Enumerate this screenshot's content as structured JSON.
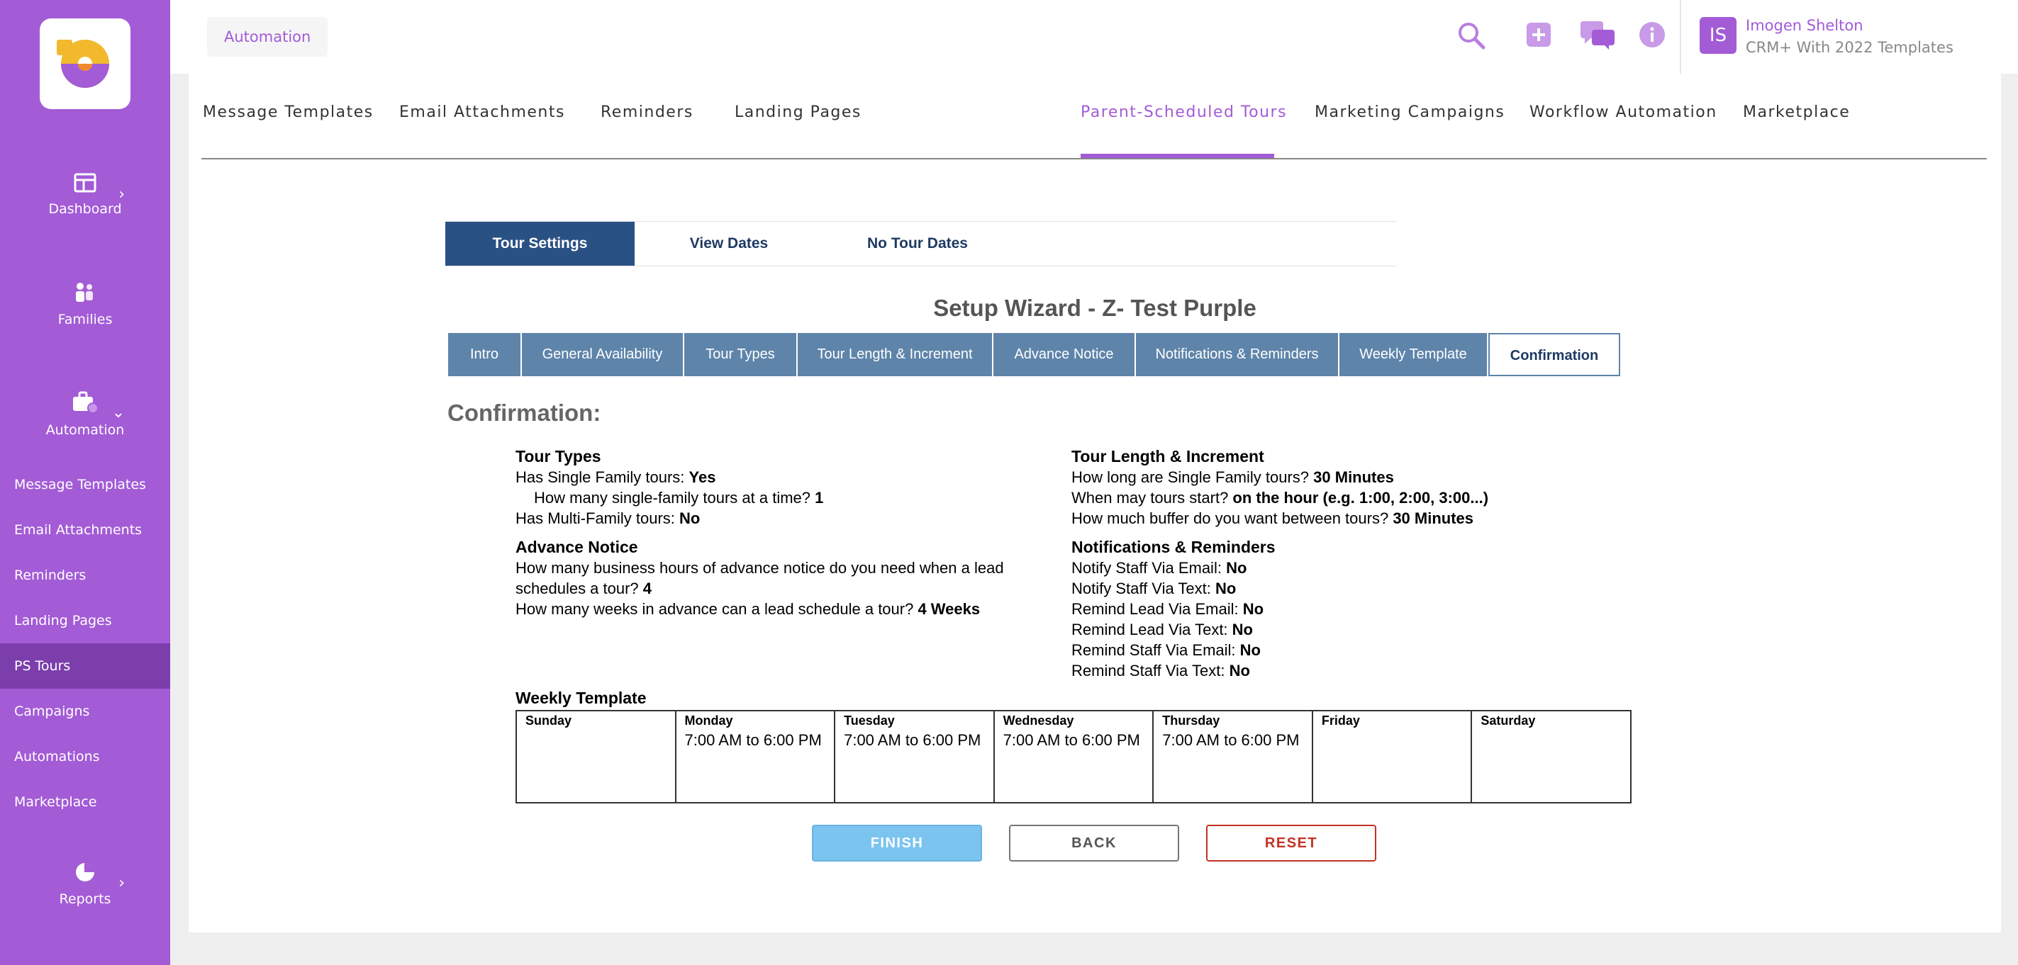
{
  "sidebar": {
    "nav": [
      {
        "label": "Dashboard",
        "icon": "dashboard-icon"
      },
      {
        "label": "Families",
        "icon": "families-icon"
      },
      {
        "label": "Automation",
        "icon": "automation-icon"
      },
      {
        "label": "Reports",
        "icon": "reports-icon"
      }
    ],
    "sub_items": [
      {
        "label": "Message Templates"
      },
      {
        "label": "Email Attachments"
      },
      {
        "label": "Reminders"
      },
      {
        "label": "Landing Pages"
      },
      {
        "label": "PS Tours",
        "active": true
      },
      {
        "label": "Campaigns"
      },
      {
        "label": "Automations"
      },
      {
        "label": "Marketplace"
      }
    ]
  },
  "topbar": {
    "breadcrumb": "Automation",
    "user": {
      "initials": "IS",
      "name": "Imogen Shelton",
      "org": "CRM+ With 2022 Templates"
    }
  },
  "tabs": [
    "Message Templates",
    "Email Attachments",
    "Reminders",
    "Landing Pages",
    "Parent-Scheduled Tours",
    "Marketing Campaigns",
    "Workflow Automation",
    "Marketplace"
  ],
  "active_tab": "Parent-Scheduled Tours",
  "subtabs": [
    "Tour Settings",
    "View Dates",
    "No Tour Dates"
  ],
  "wizard": {
    "title": "Setup Wizard - Z- Test Purple",
    "steps": [
      "Intro",
      "General Availability",
      "Tour Types",
      "Tour Length & Increment",
      "Advance Notice",
      "Notifications & Reminders",
      "Weekly Template",
      "Confirmation"
    ],
    "active_step": "Confirmation"
  },
  "confirmation": {
    "heading": "Confirmation:",
    "tour_types": {
      "title": "Tour Types",
      "q1": "Has Single Family tours: ",
      "a1": "Yes",
      "q2": "How many single-family tours at a time? ",
      "a2": "1",
      "q3": "Has Multi-Family tours: ",
      "a3": "No"
    },
    "advance_notice": {
      "title": "Advance Notice",
      "q1a": "How many business hours of advance notice do you need when a lead",
      "q1b": "schedules a tour? ",
      "a1": "4",
      "q2": "How many weeks in advance can a lead schedule a tour? ",
      "a2": "4 Weeks"
    },
    "tour_length": {
      "title": "Tour Length & Increment",
      "q1": "How long are Single Family tours? ",
      "a1": "30 Minutes",
      "q2": "When may tours start? ",
      "a2": "on the hour (e.g. 1:00, 2:00, 3:00...)",
      "q3": "How much buffer do you want between tours? ",
      "a3": "30 Minutes"
    },
    "notifications": {
      "title": "Notifications & Reminders",
      "items": [
        {
          "q": "Notify Staff Via Email: ",
          "a": "No"
        },
        {
          "q": "Notify Staff Via Text: ",
          "a": "No"
        },
        {
          "q": "Remind Lead Via Email: ",
          "a": "No"
        },
        {
          "q": "Remind Lead Via Text: ",
          "a": "No"
        },
        {
          "q": "Remind Staff Via Email: ",
          "a": "No"
        },
        {
          "q": "Remind Staff Via Text: ",
          "a": "No"
        }
      ]
    },
    "weekly_template": {
      "title": "Weekly Template",
      "days": [
        {
          "day": "Sunday",
          "time": ""
        },
        {
          "day": "Monday",
          "time": "7:00 AM to 6:00 PM"
        },
        {
          "day": "Tuesday",
          "time": "7:00 AM to 6:00 PM"
        },
        {
          "day": "Wednesday",
          "time": "7:00 AM to 6:00 PM"
        },
        {
          "day": "Thursday",
          "time": "7:00 AM to 6:00 PM"
        },
        {
          "day": "Friday",
          "time": ""
        },
        {
          "day": "Saturday",
          "time": ""
        }
      ]
    }
  },
  "buttons": {
    "finish": "FINISH",
    "back": "BACK",
    "reset": "RESET"
  },
  "colors": {
    "brand_purple": "#a35bd6",
    "nav_blue": "#2a5183",
    "step_blue": "#5e84aa",
    "finish_blue": "#7bc4ef",
    "reset_red": "#c43224"
  }
}
